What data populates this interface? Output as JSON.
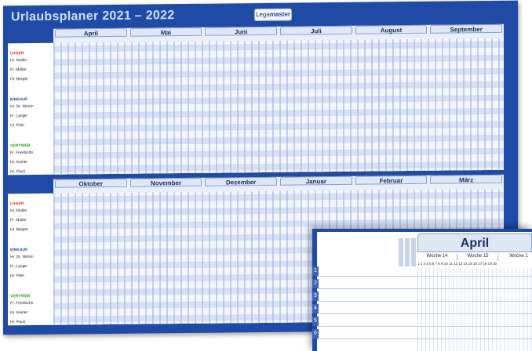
{
  "board": {
    "title": "Urlaubsplaner 2021 – 2022",
    "brand_prefix": "Lega",
    "brand_suffix": "master"
  },
  "top": {
    "months": [
      "April",
      "Mai",
      "Juni",
      "Juli",
      "August",
      "September"
    ],
    "groups": [
      {
        "label": "LAGER",
        "color": "#d93025",
        "names": [
          "Hr. Müller",
          "Fr. Müller",
          "Hr. Berger"
        ]
      },
      {
        "label": "EINKAUF",
        "color": "#1f4aa6",
        "names": [
          "Hr. Dr. Wimm",
          "Fr. Lange",
          "Hr. Petri"
        ]
      },
      {
        "label": "VERTRIEB",
        "color": "#2aa52a",
        "names": [
          "Fr. Friedrichs",
          "Hr. Keiner",
          "Hr. Pauli"
        ]
      }
    ]
  },
  "bottom": {
    "months": [
      "Oktober",
      "November",
      "Dezember",
      "Januar",
      "Februar",
      "März"
    ],
    "groups": [
      {
        "label": "LAGER",
        "color": "#d93025",
        "names": [
          "Hr. Müller",
          "Fr. Müller",
          "Hr. Berger"
        ]
      },
      {
        "label": "EINKAUF",
        "color": "#1f4aa6",
        "names": [
          "Hr. Dr. Wimm",
          "Fr. Lange",
          "Hr. Petri"
        ]
      },
      {
        "label": "VERTRIEB",
        "color": "#2aa52a",
        "names": [
          "Fr. Friedrichs",
          "Hr. Keiner",
          "Hr. Pauli"
        ]
      }
    ]
  },
  "zoom": {
    "month": "April",
    "weeks": [
      "Woche 14",
      "Woche 15",
      "Woche 1"
    ],
    "days": "1 2 3 4 5 6 7 8 9 10 11 12 13 14 15 16 17 18 19 20",
    "rows": [
      "1",
      "2",
      "3",
      "4",
      "5",
      "6"
    ]
  },
  "colors": {
    "board": "#1f4aa6",
    "lager": "#d93025",
    "einkauf": "#1f4aa6",
    "vertrieb": "#2aa52a"
  }
}
